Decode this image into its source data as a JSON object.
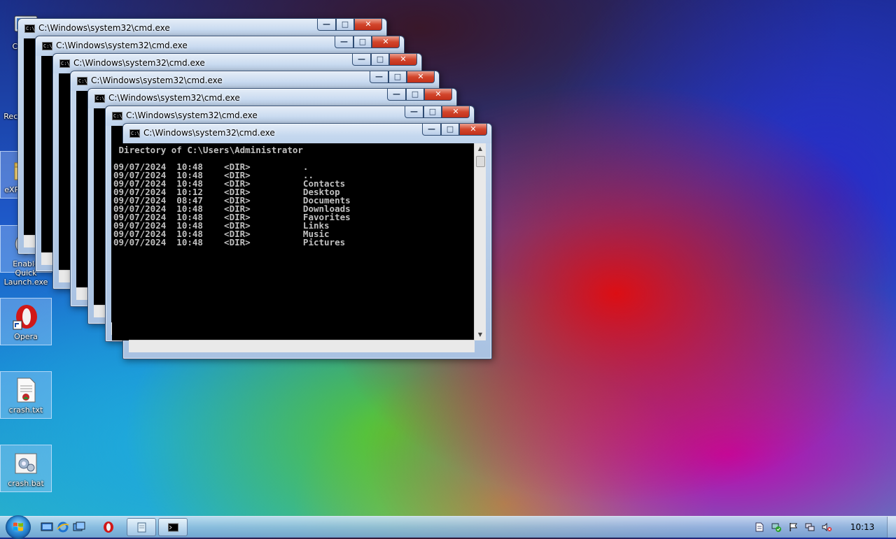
{
  "desktop": {
    "icons": [
      {
        "label": "Compu",
        "glyph": "computer-icon"
      },
      {
        "label": "Recycle Bin",
        "glyph": "recycle-bin-icon"
      },
      {
        "label": "eXPerience",
        "glyph": "folder-icon"
      },
      {
        "label": "Enable Quick Launch.exe",
        "glyph": "program-icon"
      },
      {
        "label": "Opera",
        "glyph": "opera-icon"
      },
      {
        "label": "crash.txt",
        "glyph": "text-file-icon"
      },
      {
        "label": "crash.bat",
        "glyph": "batch-file-icon"
      }
    ]
  },
  "windows": {
    "title": "C:\\Windows\\system32\\cmd.exe",
    "app_icon_text": "C:\\.",
    "buttons": {
      "minimize": "—",
      "maximize": "□",
      "close": "✕"
    },
    "count": 7
  },
  "console": {
    "lines": [
      " Directory of C:\\Users\\Administrator",
      "",
      "09/07/2024  10:48    <DIR>          .",
      "09/07/2024  10:48    <DIR>          ..",
      "09/07/2024  10:48    <DIR>          Contacts",
      "09/07/2024  10:12    <DIR>          Desktop",
      "09/07/2024  08:47    <DIR>          Documents",
      "09/07/2024  10:48    <DIR>          Downloads",
      "09/07/2024  10:48    <DIR>          Favorites",
      "09/07/2024  10:48    <DIR>          Links",
      "09/07/2024  10:48    <DIR>          Music",
      "09/07/2024  10:48    <DIR>          Pictures"
    ]
  },
  "taskbar": {
    "clock": "10:13",
    "quick_launch": [
      "show-desktop-icon",
      "ie-icon",
      "switch-windows-icon",
      "opera-icon"
    ],
    "tasks": [
      "notepad-icon",
      "cmd-icon"
    ],
    "tray": [
      "document-icon",
      "network-check-icon",
      "action-center-flag-icon",
      "network-icon",
      "volume-muted-icon"
    ]
  }
}
